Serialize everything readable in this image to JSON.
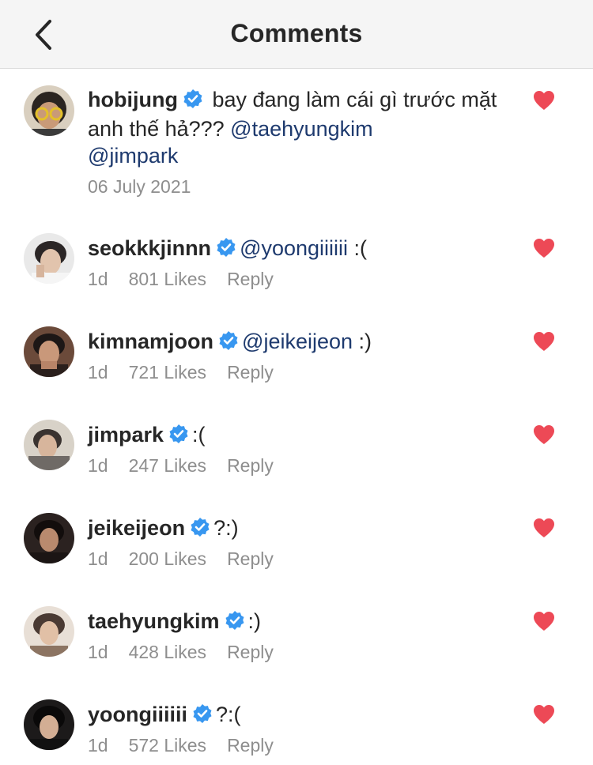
{
  "header": {
    "title": "Comments"
  },
  "caption": {
    "username": "hobijung",
    "text": " bay đang làm cái gì trước mặt anh thế hả??? ",
    "mention1": "@taehyungkim",
    "mention2": "@jimpark",
    "date": "06 July 2021"
  },
  "comments": [
    {
      "username": "seokkkjinnn",
      "mention": "@yoongiiiiii",
      "text": " :(",
      "age": "1d",
      "likes": "801 Likes",
      "reply": "Reply"
    },
    {
      "username": "kimnamjoon",
      "mention": "@jeikeijeon",
      "text": " :)",
      "age": "1d",
      "likes": "721 Likes",
      "reply": "Reply"
    },
    {
      "username": "jimpark",
      "mention": "",
      "text": ":(",
      "age": "1d",
      "likes": "247 Likes",
      "reply": "Reply"
    },
    {
      "username": "jeikeijeon",
      "mention": "",
      "text": "?:)",
      "age": "1d",
      "likes": "200 Likes",
      "reply": "Reply"
    },
    {
      "username": "taehyungkim",
      "mention": "",
      "text": ":)",
      "age": "1d",
      "likes": "428 Likes",
      "reply": "Reply"
    },
    {
      "username": "yoongiiiiii",
      "mention": "",
      "text": "?:(",
      "age": "1d",
      "likes": "572 Likes",
      "reply": "Reply"
    }
  ],
  "colors": {
    "heart": "#ed4956",
    "verified": "#3897f0",
    "mention": "#1e3a6e",
    "meta": "#8e8e8e"
  },
  "icons": {
    "back": "chevron-left-icon",
    "heart": "heart-icon",
    "verified": "verified-badge-icon"
  }
}
